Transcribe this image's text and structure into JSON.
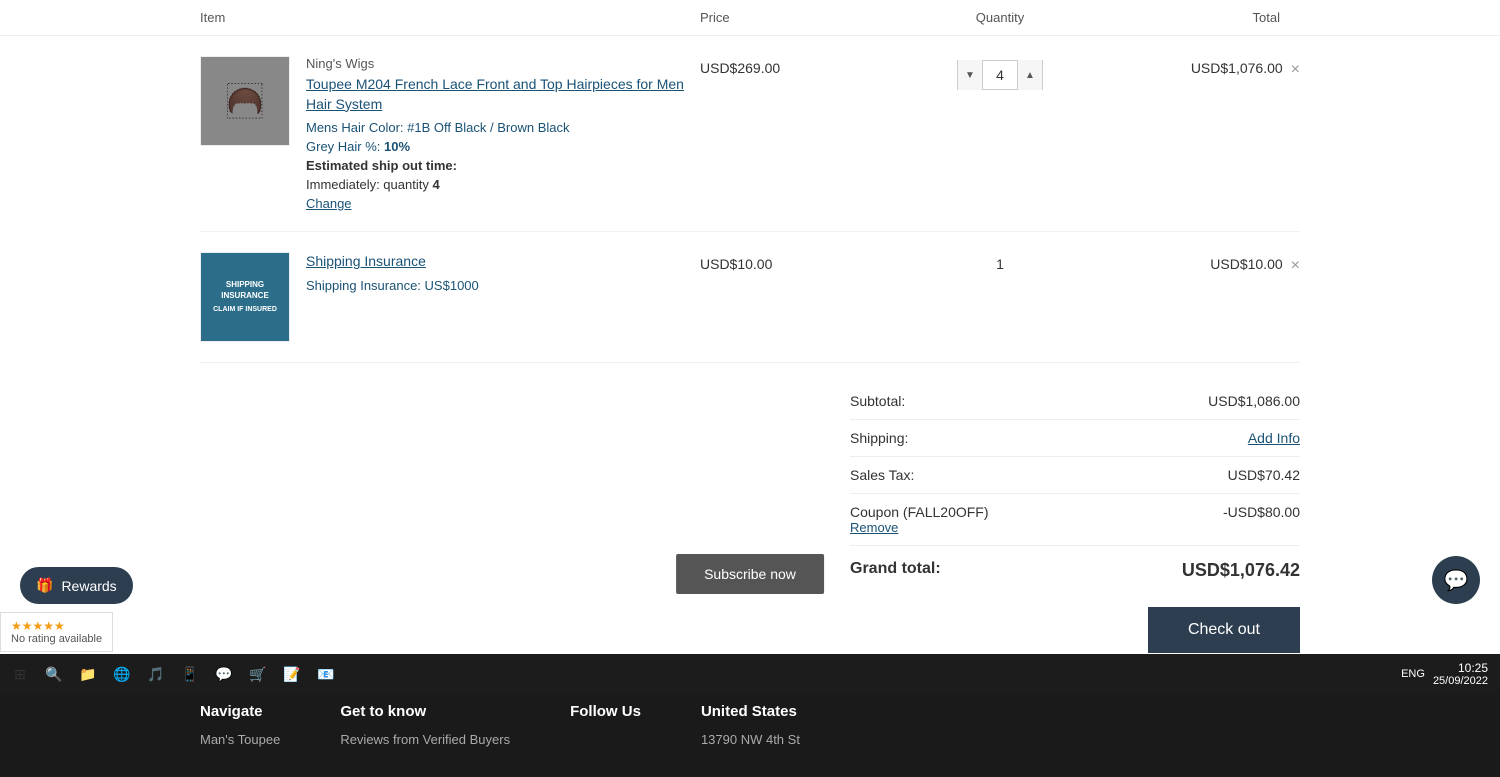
{
  "header": {
    "item_col": "Item",
    "price_col": "Price",
    "quantity_col": "Quantity",
    "total_col": "Total"
  },
  "cart": {
    "rows": [
      {
        "id": "row-1",
        "brand": "Ning's Wigs",
        "title": "Toupee M204 French Lace Front and Top Hairpieces for Men Hair System",
        "attr_label": "Mens Hair Color:",
        "attr_value": "#1B Off Black / Brown Black",
        "grey_label": "Grey Hair %:",
        "grey_value": "10%",
        "ship_label": "Estimated ship out time:",
        "ship_time": "Immediately: quantity",
        "ship_qty": "4",
        "change_link": "Change",
        "price": "USD$269.00",
        "quantity": "4",
        "total": "USD$1,076.00",
        "image_type": "wig"
      },
      {
        "id": "row-2",
        "brand": "",
        "title": "Shipping Insurance",
        "attr_label": "Shipping Insurance:",
        "attr_value": "US$1000",
        "ship_label": "",
        "ship_time": "",
        "ship_qty": "",
        "change_link": "",
        "price": "USD$10.00",
        "quantity": "1",
        "total": "USD$10.00",
        "image_type": "shipping"
      }
    ]
  },
  "summary": {
    "subtotal_label": "Subtotal:",
    "subtotal_value": "USD$1,086.00",
    "shipping_label": "Shipping:",
    "shipping_value": "Add Info",
    "sales_tax_label": "Sales Tax:",
    "sales_tax_value": "USD$70.42",
    "coupon_label": "Coupon (FALL20OFF)",
    "coupon_value": "-USD$80.00",
    "remove_label": "Remove",
    "grand_total_label": "Grand total:",
    "grand_total_value": "USD$1,076.42",
    "checkout_label": "Check out"
  },
  "footer": {
    "navigate_title": "Navigate",
    "navigate_item": "Man's Toupee",
    "get_to_know_title": "Get to know",
    "get_to_know_item": "Reviews from Verified Buyers",
    "follow_us_title": "Follow Us",
    "region_title": "United States",
    "region_address": "13790 NW 4th St"
  },
  "rewards": {
    "label": "Rewards",
    "icon": "🎁"
  },
  "subscribe": {
    "label": "Subscribe now"
  },
  "taskbar": {
    "time": "10:25",
    "date": "25/09/2022",
    "lang": "ENG"
  }
}
